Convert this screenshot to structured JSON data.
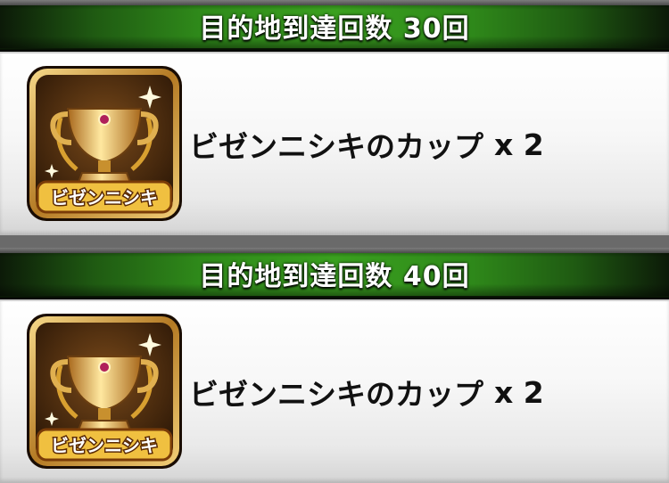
{
  "rewards": [
    {
      "header": "目的地到達回数 30回",
      "item_name": "ビゼンニシキのカップ",
      "quantity": "x 2",
      "icon_label": "ビゼンニシキ",
      "icon": "trophy-cup-icon"
    },
    {
      "header": "目的地到達回数 40回",
      "item_name": "ビゼンニシキのカップ",
      "quantity": "x 2",
      "icon_label": "ビゼンニシキ",
      "icon": "trophy-cup-icon"
    }
  ],
  "colors": {
    "header_green": "#3aa01f",
    "icon_gold": "#d8a030",
    "icon_dark": "#2a1606",
    "label_text": "#ffffff"
  }
}
